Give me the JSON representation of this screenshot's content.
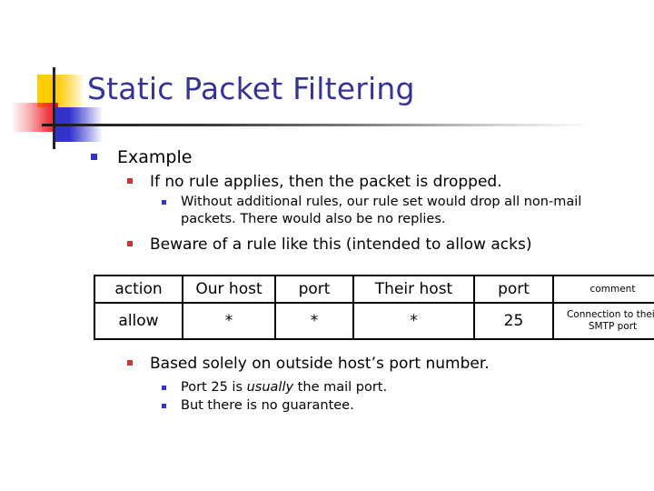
{
  "slide": {
    "title": "Static Packet Filtering",
    "accent_title_color": "#333399",
    "bullet_level1_color": "#3333CC",
    "bullet_level2_color": "#CC3333",
    "bullet_level3_color": "#3333CC"
  },
  "deco": {
    "yellow": "#FFCC00",
    "red": "#ED1C24",
    "blue": "#3333CC",
    "rule_line": "#1a1a1a"
  },
  "bullets": {
    "example": "Example",
    "no_rule": "If no rule applies, then the packet is dropped.",
    "without_rules": "Without additional rules, our rule set would drop all non-mail packets. There would also be no replies.",
    "beware": "Beware of a rule like this (intended to allow acks)",
    "based_solely": "Based solely on outside host’s port number.",
    "port25_pre": "Port 25 is ",
    "port25_em": "usually",
    "port25_post": " the mail port.",
    "no_guarantee": "But there is no guarantee."
  },
  "table": {
    "headers": [
      "action",
      "Our host",
      "port",
      "Their host",
      "port",
      "comment"
    ],
    "rows": [
      {
        "action": "allow",
        "our_host": "*",
        "our_port": "*",
        "their_host": "*",
        "their_port": "25",
        "comment": "Connection to their SMTP port"
      }
    ]
  }
}
